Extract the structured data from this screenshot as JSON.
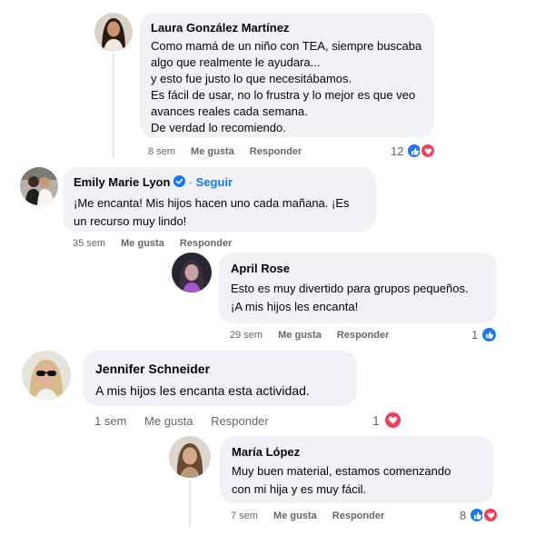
{
  "comments": [
    {
      "author": "Laura González Martínez",
      "lines": [
        "Como mamá de un niño con TEA, siempre buscaba",
        "algo que realmente le ayudara...",
        "y esto fue justo lo que necesitábamos.",
        "Es fácil de usar, no lo frustra y lo mejor es que veo",
        "avances reales cada semana.",
        "De verdad lo recomiendo."
      ],
      "time": "8 sem",
      "like": "Me gusta",
      "reply": "Responder",
      "reaction_count": "12",
      "reactions": [
        "like-icon",
        "love-icon"
      ]
    },
    {
      "author": "Emily Marie Lyon",
      "verified": true,
      "separator": "·",
      "follow": "Seguir",
      "lines": [
        "¡Me encanta! Mis hijos hacen uno cada mañana. ¡Es",
        "un recurso muy lindo!"
      ],
      "time": "35 sem",
      "like": "Me gusta",
      "reply": "Responder"
    },
    {
      "author": "April Rose",
      "lines": [
        "Esto es muy divertido para grupos pequeños.",
        "¡A mis hijos les encanta!"
      ],
      "time": "29 sem",
      "like": "Me gusta",
      "reply": "Responder",
      "reaction_count": "1",
      "reactions": [
        "like-icon"
      ]
    },
    {
      "author": "Jennifer Schneider",
      "lines": [
        "A mis hijos les encanta esta actividad."
      ],
      "time": "1 sem",
      "like": "Me gusta",
      "reply": "Responder",
      "reaction_count": "1",
      "reactions": [
        "love-icon"
      ]
    },
    {
      "author": "María López",
      "lines": [
        "Muy buen material, estamos comenzando",
        "con mi hija y es muy fácil."
      ],
      "time": "7 sem",
      "like": "Me gusta",
      "reply": "Responder",
      "reaction_count": "8",
      "reactions": [
        "like-icon",
        "love-icon"
      ]
    }
  ],
  "colors": {
    "bubble": "#f0f2f5",
    "meta": "#65676b",
    "link": "#1877f2",
    "like": "#1877f2",
    "love": "#f33e58"
  }
}
